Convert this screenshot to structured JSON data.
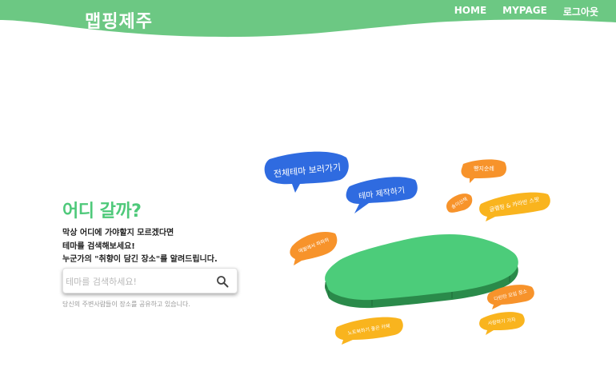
{
  "header": {
    "logo": "맵핑제주",
    "nav": {
      "home": "HOME",
      "mypage": "MYPAGE",
      "logout": "로그아웃"
    },
    "color": "#6cc883"
  },
  "hero": {
    "headline": "어디 갈까?",
    "lines": [
      "막상 어디에 가야할지 모르겠다면",
      "테마를 검색해보세요!",
      "누군가의 \"취향이 담긴 장소\"를 알려드립니다."
    ],
    "search": {
      "placeholder": "테마를 검색하세요!",
      "value": ""
    },
    "subtext": "당신의 주변사람들이 장소를 공유하고 있습니다."
  },
  "bubbles": {
    "all_themes": "전체테마 보러가기",
    "make_theme": "테마 제작하기",
    "bbangji": "빵지순례",
    "songee": "송이산책",
    "glamping": "글램핑 & 카라반 스팟",
    "sunset": "애월에서 하하하",
    "date": "다린탄 모임 장소",
    "notebook": "노트북하기 좋은 카페",
    "photo": "사랑하기 가자"
  },
  "colors": {
    "blue": "#2f6be0",
    "orange": "#f7932b",
    "gold": "#f9b41e",
    "island": "#4ccc7a",
    "island_side": "#2a8a4a",
    "accent": "#4ec97a"
  }
}
